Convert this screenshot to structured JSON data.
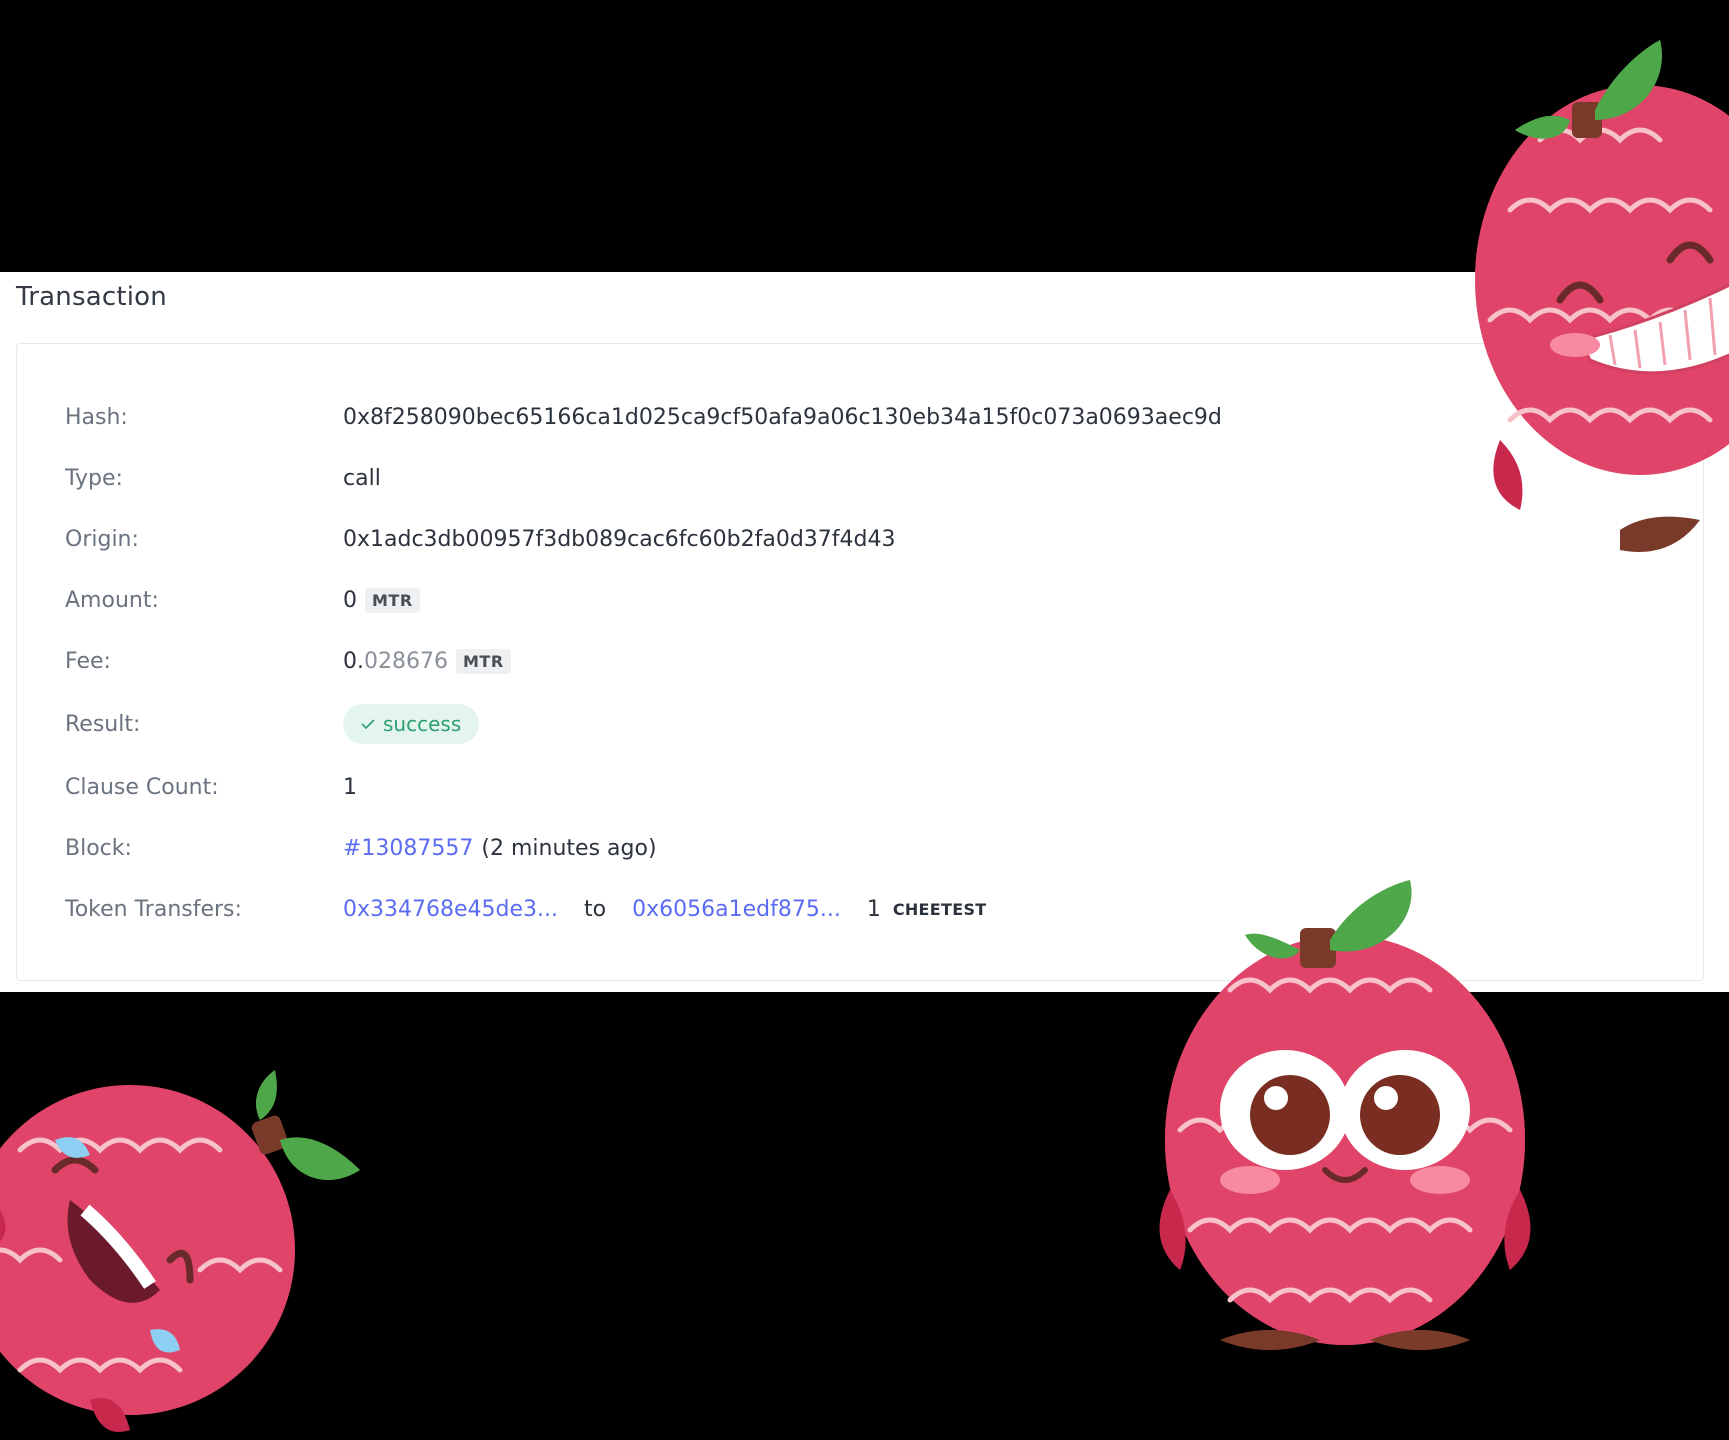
{
  "panel": {
    "title": "Transaction"
  },
  "fields": {
    "hash": {
      "label": "Hash:",
      "value": "0x8f258090bec65166ca1d025ca9cf50afa9a06c130eb34a15f0c073a0693aec9d"
    },
    "type": {
      "label": "Type:",
      "value": "call"
    },
    "origin": {
      "label": "Origin:",
      "value": "0x1adc3db00957f3db089cac6fc60b2fa0d37f4d43"
    },
    "amount": {
      "label": "Amount:",
      "value": "0",
      "unit": "MTR"
    },
    "fee": {
      "label": "Fee:",
      "value_int": "0.",
      "value_dec": "028676",
      "unit": "MTR"
    },
    "result": {
      "label": "Result:",
      "value": "success"
    },
    "clause_count": {
      "label": "Clause Count:",
      "value": "1"
    },
    "block": {
      "label": "Block:",
      "number": "#13087557",
      "age": "(2 minutes ago)"
    },
    "token_transfers": {
      "label": "Token Transfers:",
      "from": "0x334768e45de3...",
      "to_word": "to",
      "to": "0x6056a1edf875...",
      "amount": "1",
      "unit": "CHEETEST"
    }
  },
  "colors": {
    "background": "#000000",
    "link": "#5b6cf2",
    "success_bg": "#e3f5ee",
    "success_text": "#2d9f6f",
    "mascot_body": "#e04468",
    "mascot_swirl": "#f7c2c9",
    "leaf": "#4ea84a"
  }
}
